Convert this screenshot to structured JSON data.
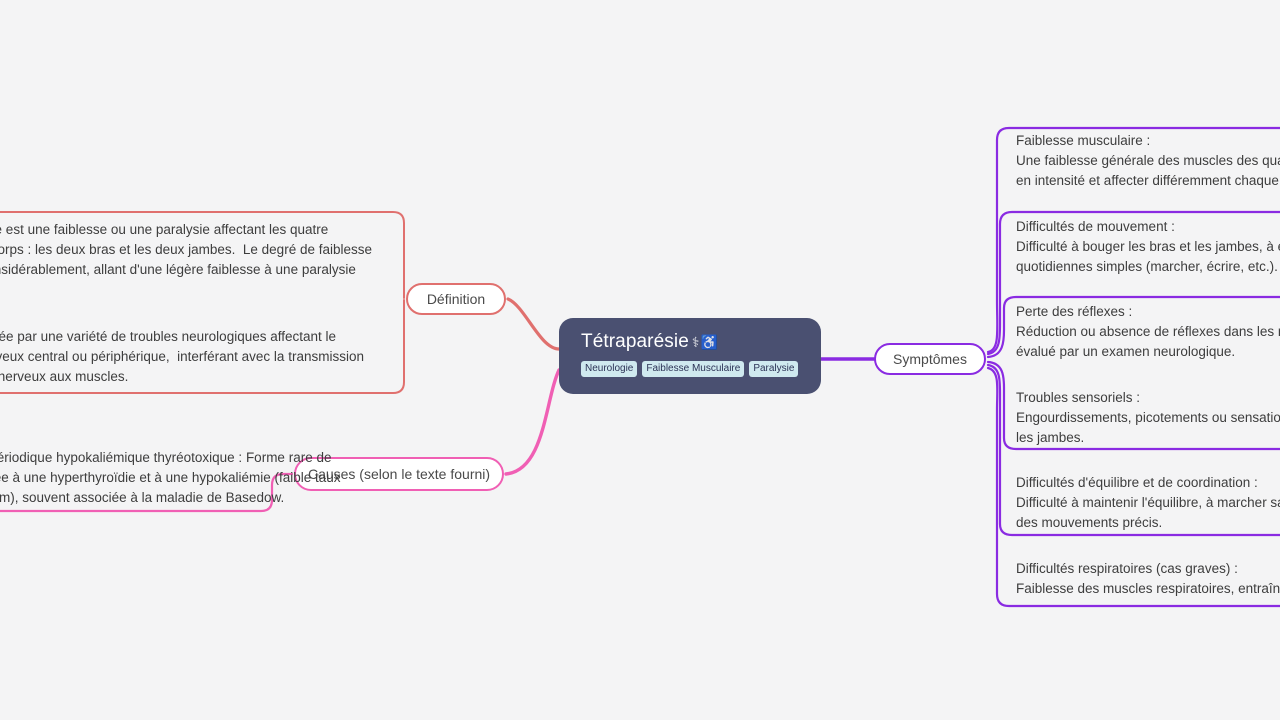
{
  "canvas": {
    "background": "#f4f4f5",
    "type": "mindmap"
  },
  "central": {
    "title": "Tétraparésie",
    "emoji": "⚕♿",
    "background": "#4a5071",
    "text_color": "#ffffff",
    "tags": [
      {
        "label": "Neurologie"
      },
      {
        "label": "Faiblesse Musculaire"
      },
      {
        "label": "Paralysie"
      }
    ],
    "tag_background": "#cfe9ef",
    "tag_color": "#2c3356"
  },
  "branches": [
    {
      "id": "definition",
      "label": "Définition",
      "color": "#e0706e",
      "side": "left",
      "items": [
        {
          "text": "La tétraparésie est une faiblesse ou une paralysie affectant les quatre\nmembres du corps : les deux bras et les deux jambes.  Le degré de faiblesse\npeut varier considérablement, allant d'une légère faiblesse à une paralysie\ncomplète."
        },
        {
          "text": "Elle est causée par une variété de troubles neurologiques affectant le\nsystème nerveux central ou périphérique,  interférant avec la transmission\ndes signaux nerveux aux muscles."
        }
      ]
    },
    {
      "id": "causes",
      "label": "Causes (selon le texte fourni)",
      "color": "#f05fb4",
      "side": "left",
      "items": [
        {
          "text": "Paralysie périodique hypokaliémique thyréotoxique : Forme rare de\nparalysie liée à une hyperthyroïdie et à une hypokaliémie (faible taux\nde potassium), souvent associée à la maladie de Basedow."
        }
      ]
    },
    {
      "id": "symptomes",
      "label": "Symptômes",
      "color": "#8a2be2",
      "side": "right",
      "items": [
        {
          "text": "Faiblesse musculaire :\nUne faiblesse générale des muscles des quatre membres, pouvant varier\nen intensité et affecter différemment chaque membre."
        },
        {
          "text": "Difficultés de mouvement :\nDifficulté à bouger les bras et les jambes, à effectuer des tâches\nquotidiennes simples (marcher, écrire, etc.)."
        },
        {
          "text": "Perte des réflexes :\nRéduction ou absence de réflexes dans les membres atteints,\névalué par un examen neurologique."
        },
        {
          "text": "Troubles sensoriels :\nEngourdissements, picotements ou sensations anormales dans les bras et\nles jambes."
        },
        {
          "text": "Difficultés d'équilibre et de coordination :\nDifficulté à maintenir l'équilibre, à marcher sans aide, ou à effectuer\ndes mouvements précis."
        },
        {
          "text": "Difficultés respiratoires (cas graves) :\nFaiblesse des muscles respiratoires, entraînant des difficultés à respirer."
        }
      ]
    }
  ]
}
